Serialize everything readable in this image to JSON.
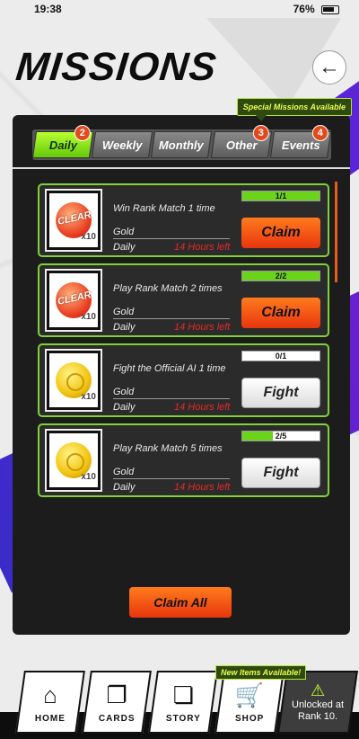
{
  "status_bar": {
    "time": "19:38",
    "battery": "76%"
  },
  "header": {
    "title": "MISSIONS",
    "back_icon": "←"
  },
  "special_banner": "Special Missions Available",
  "tabs": [
    {
      "label": "Daily",
      "badge": "2",
      "active": true
    },
    {
      "label": "Weekly",
      "badge": "",
      "active": false
    },
    {
      "label": "Monthly",
      "badge": "",
      "active": false
    },
    {
      "label": "Other",
      "badge": "3",
      "active": false
    },
    {
      "label": "Events",
      "badge": "4",
      "active": false
    }
  ],
  "missions": [
    {
      "title": "Win Rank Match 1 time",
      "reward": "Gold",
      "period": "Daily",
      "time_left": "14 Hours left",
      "progress_text": "1/1",
      "progress": 1.0,
      "action": "Claim",
      "medal": "clear",
      "qty": "x10"
    },
    {
      "title": "Play Rank Match 2 times",
      "reward": "Gold",
      "period": "Daily",
      "time_left": "14 Hours left",
      "progress_text": "2/2",
      "progress": 1.0,
      "action": "Claim",
      "medal": "clear",
      "qty": "x10"
    },
    {
      "title": "Fight the Official AI 1 time",
      "reward": "Gold",
      "period": "Daily",
      "time_left": "14 Hours left",
      "progress_text": "0/1",
      "progress": 0.0,
      "action": "Fight",
      "medal": "gold",
      "qty": "x10"
    },
    {
      "title": "Play Rank Match 5 times",
      "reward": "Gold",
      "period": "Daily",
      "time_left": "14 Hours left",
      "progress_text": "2/5",
      "progress": 0.4,
      "action": "Fight",
      "medal": "gold",
      "qty": "x10"
    }
  ],
  "claim_all": "Claim All",
  "bottom_nav": {
    "new_items": "New Items Available!",
    "items": [
      {
        "label": "HOME",
        "icon": "⌂"
      },
      {
        "label": "CARDS",
        "icon": "❐"
      },
      {
        "label": "STORY",
        "icon": "❏"
      },
      {
        "label": "SHOP",
        "icon": "🛒"
      }
    ],
    "locked": {
      "line1": "Unlocked at",
      "line2": "Rank 10."
    }
  }
}
